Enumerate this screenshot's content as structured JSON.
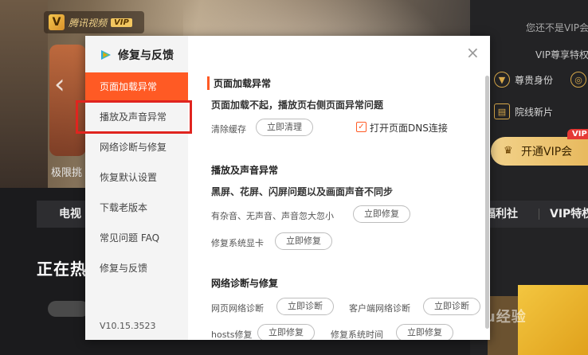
{
  "background": {
    "logo_text": "腾讯视频",
    "logo_badge": "VIP",
    "banner_caption": "极限挑",
    "right_column": {
      "login_text": "您还不是VIP会",
      "vip_head": "VIP尊享特权",
      "items": [
        {
          "label": "尊贵身份",
          "icon": "crown-icon"
        },
        {
          "label": "院线新片",
          "icon": "film-icon"
        }
      ],
      "open_vip_label": "开通VIP会",
      "corner_badge": "VIP"
    },
    "nav": [
      "电视",
      "福利社",
      "VIP特权"
    ],
    "section_title": "正在热",
    "watermark": "Baidu经验"
  },
  "dialog": {
    "title": "修复与反馈",
    "version": "V10.15.3523",
    "sidebar": [
      {
        "label": "页面加载异常",
        "active": true
      },
      {
        "label": "播放及声音异常",
        "active": false
      },
      {
        "label": "网络诊断与修复",
        "active": false
      },
      {
        "label": "恢复默认设置",
        "active": false
      },
      {
        "label": "下载老版本",
        "active": false
      },
      {
        "label": "常见问题 FAQ",
        "active": false
      },
      {
        "label": "修复与反馈",
        "active": false
      }
    ],
    "sections": {
      "page_load": {
        "heading": "页面加载异常",
        "subtitle": "页面加载不起，播放页右侧页面异常问题",
        "clear_cache_label": "清除缓存",
        "clear_cache_button": "立即清理",
        "dns_checkbox_label": "打开页面DNS连接",
        "dns_checked": true
      },
      "playback": {
        "heading": "播放及声音异常",
        "subtitle": "黑屏、花屏、闪屏问题以及画面声音不同步",
        "noise_label": "有杂音、无声音、声音忽大忽小",
        "noise_button": "立即修复",
        "gpu_label": "修复系统显卡",
        "gpu_button": "立即修复"
      },
      "network": {
        "heading": "网络诊断与修复",
        "web_label": "网页网络诊断",
        "web_button": "立即诊断",
        "client_label": "客户端网络诊断",
        "client_button": "立即诊断",
        "hosts_label": "hosts修复",
        "hosts_button": "立即修复",
        "time_label": "修复系统时间",
        "time_button": "立即修复"
      }
    }
  },
  "colors": {
    "accent": "#ff5a24",
    "highlight_box": "#e0241f",
    "vip_gold": "#e6b658"
  }
}
